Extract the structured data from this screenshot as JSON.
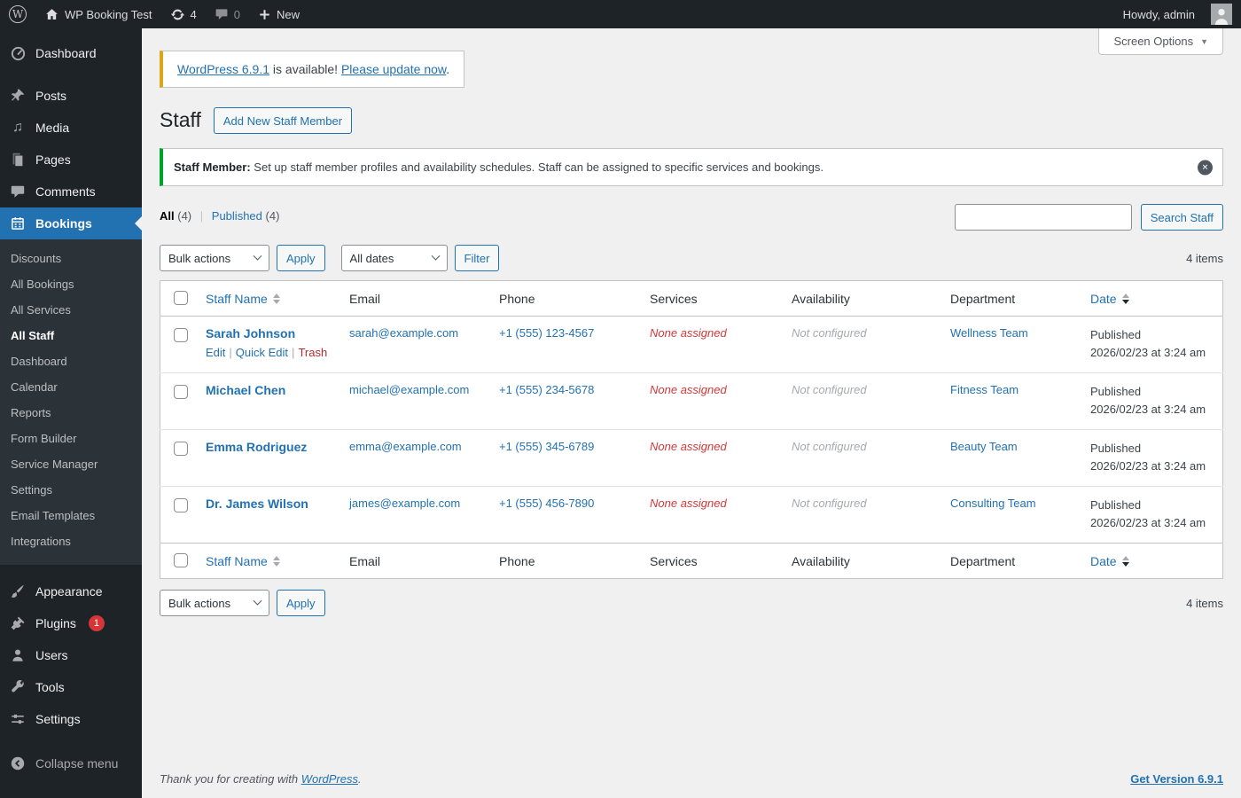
{
  "colors": {
    "accent": "#2271b1",
    "danger": "#d63638",
    "success_notice_border": "#00a32a",
    "update_nag_border": "#dba617",
    "admin_bar_bg": "#1d2327",
    "submenu_bg": "#2c3338",
    "page_bg": "#f0f0f1"
  },
  "icons": {
    "wp_logo_glyph": "W",
    "dropdown_caret": "▼",
    "dismiss_glyph": "✕",
    "media_note_glyph": "♫"
  },
  "admin_bar": {
    "site_name": "WP Booking Test",
    "update_count": "4",
    "comment_count": "0",
    "new_label": "New",
    "howdy": "Howdy, admin"
  },
  "sidebar": {
    "items": [
      {
        "label": "Dashboard",
        "icon": "dashboard-icon"
      },
      {
        "label": "Posts",
        "icon": "pin-icon"
      },
      {
        "label": "Media",
        "icon": "media-icon"
      },
      {
        "label": "Pages",
        "icon": "pages-icon"
      },
      {
        "label": "Comments",
        "icon": "comments-icon"
      },
      {
        "label": "Bookings",
        "icon": "calendar-icon",
        "active": true
      },
      {
        "label": "Appearance",
        "icon": "brush-icon"
      },
      {
        "label": "Plugins",
        "icon": "plugin-icon",
        "badge": "1"
      },
      {
        "label": "Users",
        "icon": "user-icon"
      },
      {
        "label": "Tools",
        "icon": "wrench-icon"
      },
      {
        "label": "Settings",
        "icon": "sliders-icon"
      },
      {
        "label": "Collapse menu",
        "icon": "collapse-icon"
      }
    ],
    "bookings_submenu": [
      {
        "label": "Discounts"
      },
      {
        "label": "All Bookings"
      },
      {
        "label": "All Services"
      },
      {
        "label": "All Staff",
        "current": true
      },
      {
        "label": "Dashboard"
      },
      {
        "label": "Calendar"
      },
      {
        "label": "Reports"
      },
      {
        "label": "Form Builder"
      },
      {
        "label": "Service Manager"
      },
      {
        "label": "Settings"
      },
      {
        "label": "Email Templates"
      },
      {
        "label": "Integrations"
      }
    ]
  },
  "main": {
    "screen_options": "Screen Options",
    "update_nag": {
      "version_link": "WordPress 6.9.1",
      "middle_text": " is available! ",
      "update_link": "Please update now",
      "suffix": "."
    },
    "page_title": "Staff",
    "add_new_button": "Add New Staff Member",
    "notice": {
      "bold": "Staff Member:",
      "text": " Set up staff member profiles and availability schedules. Staff can be assigned to specific services and bookings."
    },
    "views": {
      "all_label": "All",
      "all_count": "(4)",
      "separator": "|",
      "published_label": "Published",
      "published_count": "(4)"
    },
    "search_button": "Search Staff",
    "tablenav": {
      "bulk_actions": "Bulk actions",
      "apply": "Apply",
      "all_dates": "All dates",
      "filter": "Filter",
      "items_count": "4 items"
    },
    "table": {
      "columns": [
        "Staff Name",
        "Email",
        "Phone",
        "Services",
        "Availability",
        "Department",
        "Date"
      ],
      "action_sep": "|",
      "rows": [
        {
          "name": "Sarah Johnson",
          "email": "sarah@example.com",
          "phone": "+1 (555) 123-4567",
          "services": "None assigned",
          "availability": "Not configured",
          "department": "Wellness Team",
          "status": "Published",
          "date": "2026/02/23 at 3:24 am",
          "actions": {
            "edit": "Edit",
            "quick_edit": "Quick Edit",
            "trash": "Trash"
          }
        },
        {
          "name": "Michael Chen",
          "email": "michael@example.com",
          "phone": "+1 (555) 234-5678",
          "services": "None assigned",
          "availability": "Not configured",
          "department": "Fitness Team",
          "status": "Published",
          "date": "2026/02/23 at 3:24 am"
        },
        {
          "name": "Emma Rodriguez",
          "email": "emma@example.com",
          "phone": "+1 (555) 345-6789",
          "services": "None assigned",
          "availability": "Not configured",
          "department": "Beauty Team",
          "status": "Published",
          "date": "2026/02/23 at 3:24 am"
        },
        {
          "name": "Dr. James Wilson",
          "email": "james@example.com",
          "phone": "+1 (555) 456-7890",
          "services": "None assigned",
          "availability": "Not configured",
          "department": "Consulting Team",
          "status": "Published",
          "date": "2026/02/23 at 3:24 am"
        }
      ]
    },
    "footer": {
      "thanks_prefix": "Thank you for creating with ",
      "wordpress_link": "WordPress",
      "suffix": ".",
      "version_link": "Get Version 6.9.1"
    }
  }
}
